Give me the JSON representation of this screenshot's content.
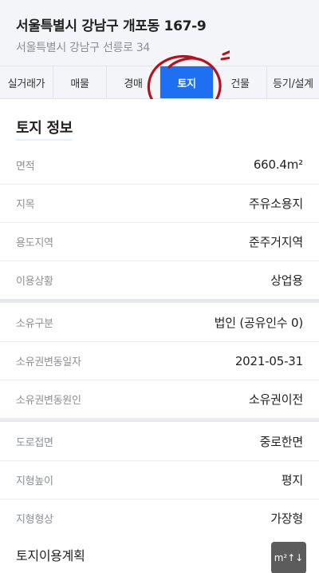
{
  "header": {
    "address_main": "서울특별시 강남구 개포동 167-9",
    "address_sub": "서울특별시 강남구 선릉로 34"
  },
  "tabs": [
    {
      "label": "실거래가",
      "active": false
    },
    {
      "label": "매물",
      "active": false
    },
    {
      "label": "경매",
      "active": false
    },
    {
      "label": "토지",
      "active": true
    },
    {
      "label": "건물",
      "active": false
    },
    {
      "label": "등기/설계",
      "active": false
    }
  ],
  "section": {
    "title": "토지 정보"
  },
  "groups": [
    [
      {
        "label": "면적",
        "value": "660.4m²"
      },
      {
        "label": "지목",
        "value": "주유소용지"
      },
      {
        "label": "용도지역",
        "value": "준주거지역"
      },
      {
        "label": "이용상황",
        "value": "상업용"
      }
    ],
    [
      {
        "label": "소유구분",
        "value": "법인 (공유인수 0)"
      },
      {
        "label": "소유권변동일자",
        "value": "2021-05-31"
      },
      {
        "label": "소유권변동원인",
        "value": "소유권이전"
      }
    ],
    [
      {
        "label": "도로접면",
        "value": "중로한면"
      },
      {
        "label": "지형높이",
        "value": "평지"
      },
      {
        "label": "지형형상",
        "value": "가장형"
      }
    ]
  ],
  "plan": {
    "title": "토지이용계획",
    "unit_button": "m²↑↓"
  },
  "colors": {
    "accent": "#1f6ff2",
    "annotation": "#b3121e",
    "unit_button_bg": "#5c5c5c"
  }
}
